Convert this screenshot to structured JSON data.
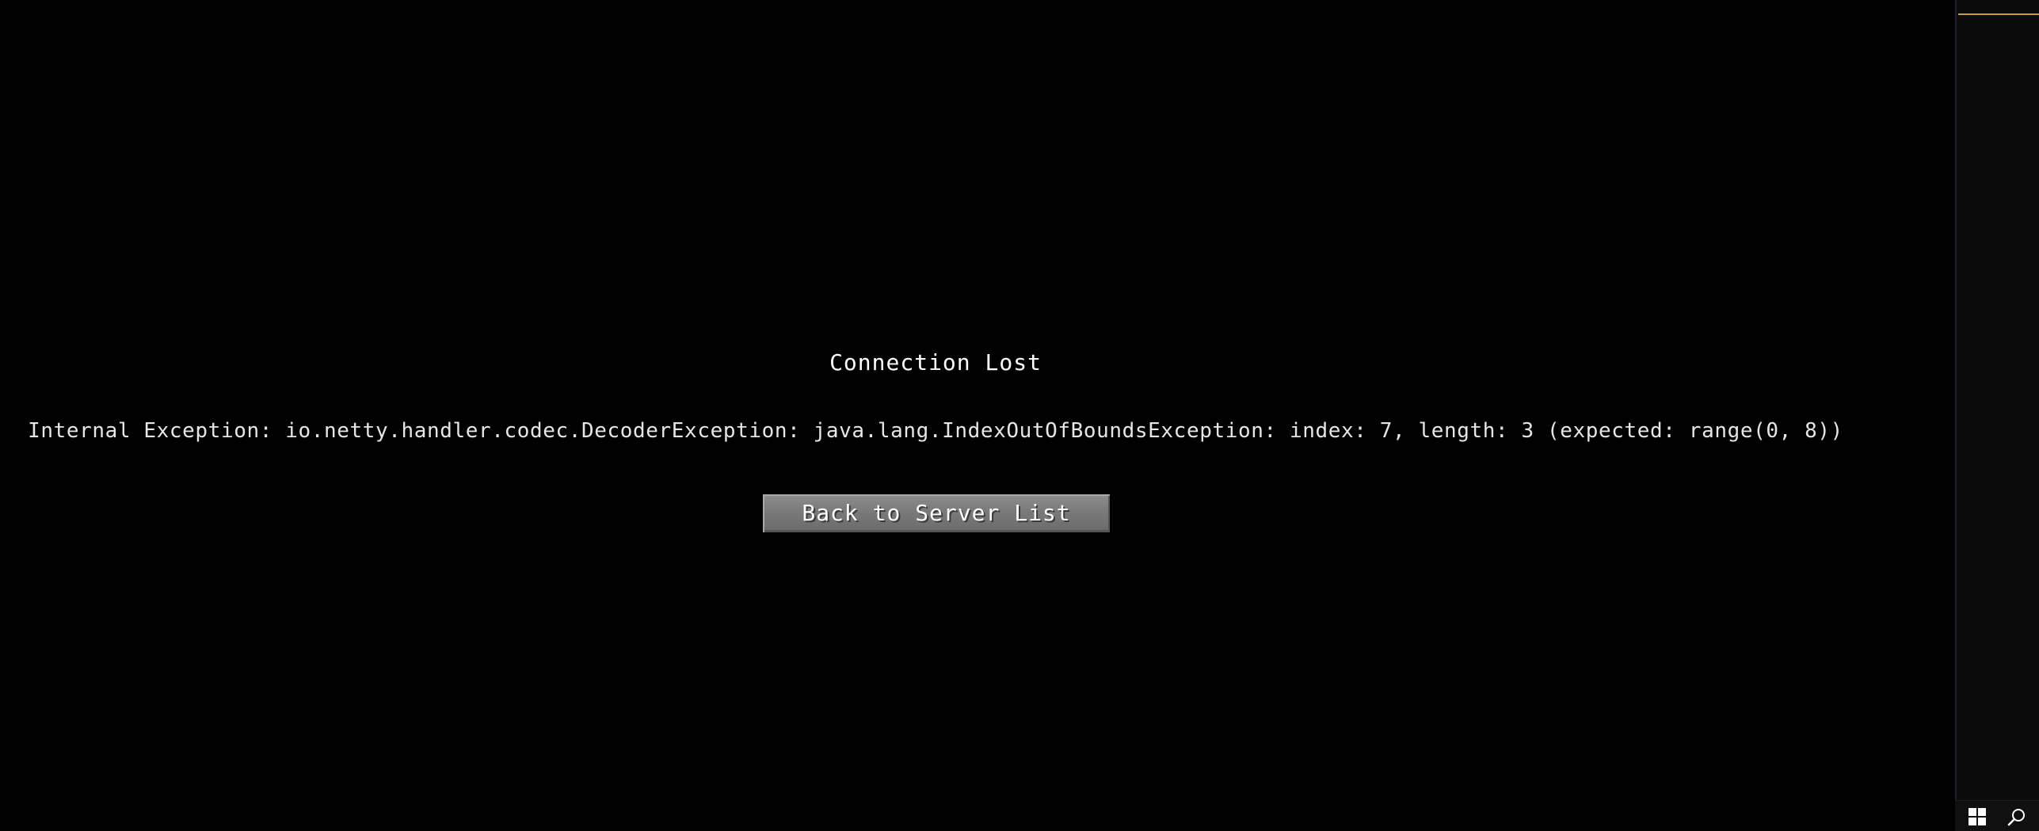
{
  "dialog": {
    "title": "Connection Lost",
    "message": "Internal Exception: io.netty.handler.codec.DecoderException: java.lang.IndexOutOfBoundsException: index: 7, length: 3 (expected: range(0, 8))",
    "back_button_label": "Back to Server List"
  },
  "taskbar": {
    "icons": [
      "windows-start-icon",
      "search-icon"
    ]
  },
  "colors": {
    "background": "#000000",
    "text": "#ffffff",
    "button_face": "#7a7a7a",
    "side_accent": "#c99a45"
  }
}
